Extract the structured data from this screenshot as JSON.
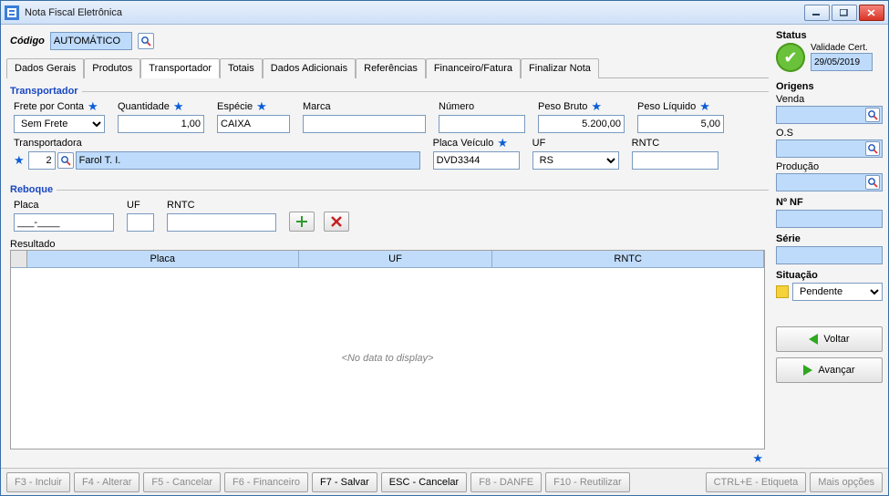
{
  "window": {
    "title": "Nota Fiscal Eletrônica"
  },
  "codigo": {
    "label": "Código",
    "value": "AUTOMÁTICO"
  },
  "tabs": [
    "Dados Gerais",
    "Produtos",
    "Transportador",
    "Totais",
    "Dados Adicionais",
    "Referências",
    "Financeiro/Fatura",
    "Finalizar Nota"
  ],
  "active_tab": 2,
  "transportador": {
    "title": "Transportador",
    "frete": {
      "label": "Frete por Conta",
      "value": "Sem Frete"
    },
    "quantidade": {
      "label": "Quantidade",
      "value": "1,00"
    },
    "especie": {
      "label": "Espécie",
      "value": "CAIXA"
    },
    "marca": {
      "label": "Marca",
      "value": ""
    },
    "numero": {
      "label": "Número",
      "value": ""
    },
    "peso_bruto": {
      "label": "Peso Bruto",
      "value": "5.200,00"
    },
    "peso_liquido": {
      "label": "Peso Líquido",
      "value": "5,00"
    },
    "transportadora": {
      "label": "Transportadora",
      "id": "2",
      "name": "Farol T. I."
    },
    "placa_veic": {
      "label": "Placa Veículo",
      "value": "DVD3344"
    },
    "uf": {
      "label": "UF",
      "value": "RS"
    },
    "rntc": {
      "label": "RNTC",
      "value": ""
    }
  },
  "reboque": {
    "title": "Reboque",
    "placa": {
      "label": "Placa",
      "value": "___-____"
    },
    "uf": {
      "label": "UF",
      "value": ""
    },
    "rntc": {
      "label": "RNTC",
      "value": ""
    },
    "resultado_label": "Resultado",
    "columns": [
      "Placa",
      "UF",
      "RNTC"
    ],
    "empty_text": "<No data to display>"
  },
  "footer": {
    "f3": "F3 - Incluir",
    "f4": "F4 - Alterar",
    "f5": "F5 - Cancelar",
    "f6": "F6 - Financeiro",
    "f7": "F7 - Salvar",
    "esc": "ESC - Cancelar",
    "f8": "F8 - DANFE",
    "f10": "F10 - Reutilizar",
    "ctrle": "CTRL+E - Etiqueta",
    "mais": "Mais opções"
  },
  "status": {
    "title": "Status",
    "cert_label": "Validade Cert.",
    "cert_date": "29/05/2019",
    "origens_title": "Origens",
    "venda": "Venda",
    "os": "O.S",
    "producao": "Produção",
    "nonf": "Nº NF",
    "serie": "Série",
    "situacao_title": "Situação",
    "situacao_value": "Pendente",
    "voltar": "Voltar",
    "avancar": "Avançar"
  }
}
